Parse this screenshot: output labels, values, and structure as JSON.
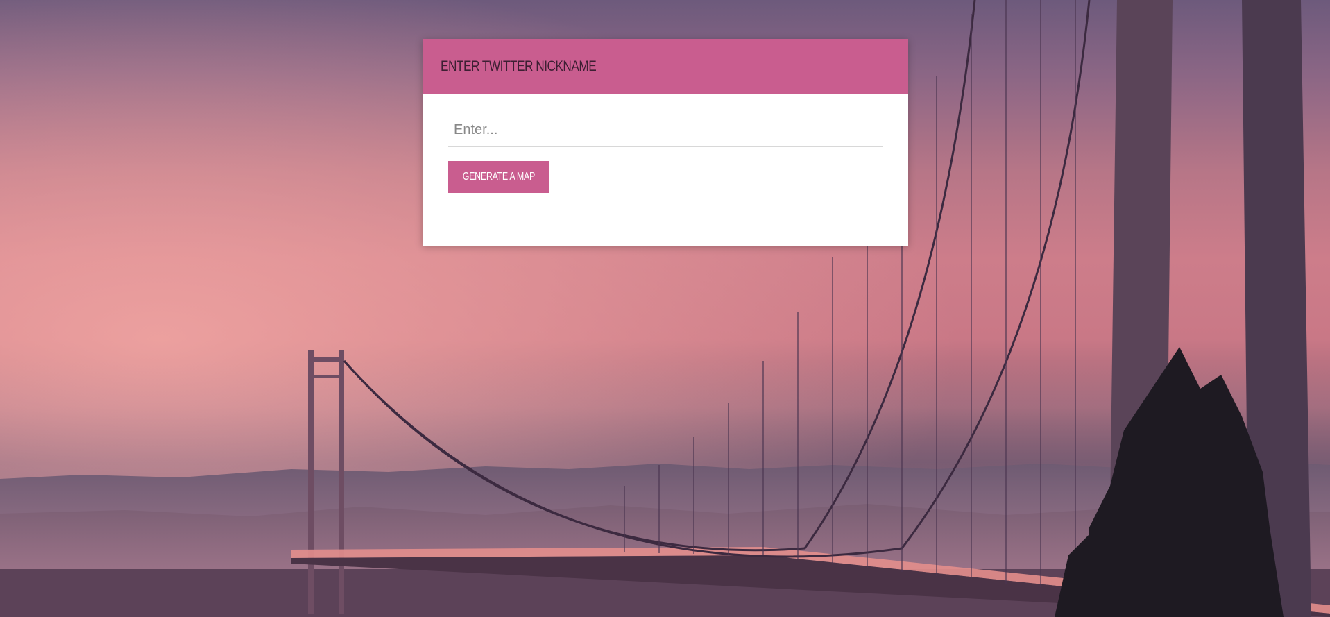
{
  "card": {
    "title": "ENTER TWITTER NICKNAME",
    "input_placeholder": "Enter...",
    "input_value": "",
    "button_label": "GENERATE A MAP"
  },
  "colors": {
    "accent": "#c95d8f",
    "header_text": "#3d1f33",
    "card_background": "#ffffff"
  },
  "background": {
    "icon": "suspension-bridge-sunset-photo"
  }
}
